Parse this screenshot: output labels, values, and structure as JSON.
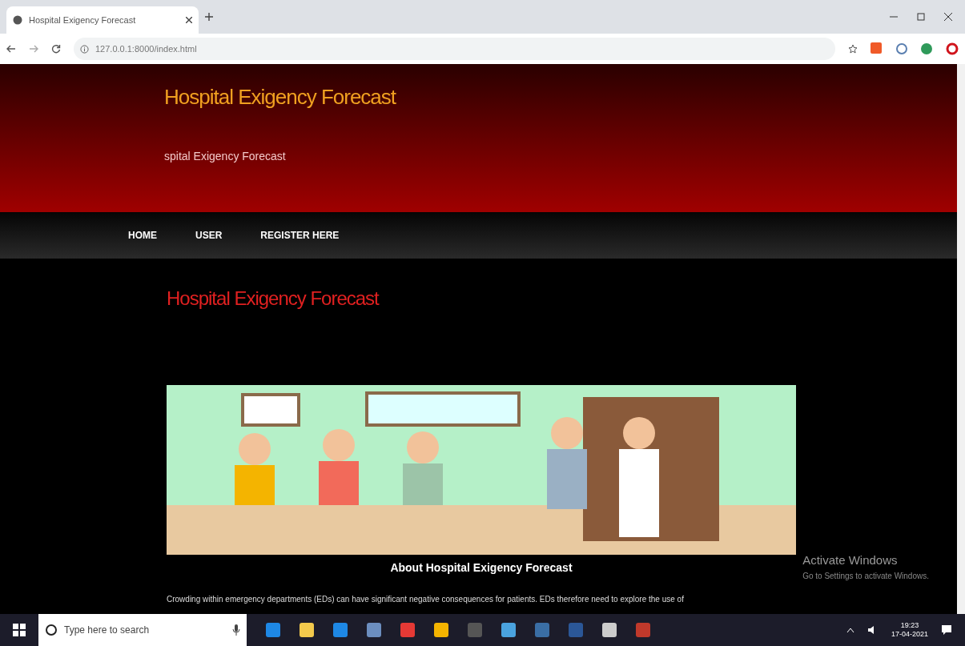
{
  "browser": {
    "tab_title": "Hospital Exigency Forecast",
    "url": "127.0.0.1:8000/index.html"
  },
  "site": {
    "title": "Hospital Exigency Forecast",
    "subtitle": "spital Exigency Forecast"
  },
  "nav": [
    {
      "label": "HOME"
    },
    {
      "label": "USER"
    },
    {
      "label": "REGISTER HERE"
    }
  ],
  "heading": "Hospital Exigency Forecast",
  "about_title": "About Hospital Exigency Forecast",
  "paragraph": "Crowding within emergency departments (EDs) can have significant negative consequences for patients. EDs therefore need to explore the use of",
  "activation": {
    "title": "Activate Windows",
    "subtitle": "Go to Settings to activate Windows."
  },
  "taskbar": {
    "search_placeholder": "Type here to search",
    "time": "19:23",
    "date": "17-04-2021"
  }
}
